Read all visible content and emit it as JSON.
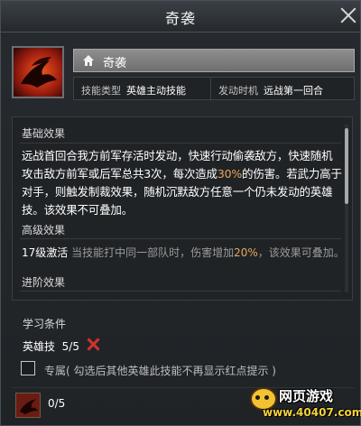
{
  "window": {
    "title": "奇袭"
  },
  "skill": {
    "name": "奇袭",
    "type_label": "技能类型",
    "type_value": "英雄主动技能",
    "timing_label": "发动时机",
    "timing_value": "远战第一回合"
  },
  "basic_effect": {
    "heading": "基础效果",
    "text_before": "远战首回合我方前军存活时发动，快速行动偷袭敌方，快速随机攻击敌方前军或后军总共3次，每次造成",
    "highlight": "30%",
    "text_after": "的伤害。若武力高于对手，则触发制裁效果，随机沉默敌方任意一个仍未发动的英雄技。该效果不可叠加。"
  },
  "advanced_effect": {
    "heading": "高级效果",
    "level_label": "17级激活",
    "text_before": " 当技能打中同一部队时，伤害增加",
    "highlight": "20%",
    "text_after": "，该效果可叠加。"
  },
  "promotion_effect": {
    "heading": "进阶效果"
  },
  "learn": {
    "heading": "学习条件",
    "requirement_label": "英雄技",
    "requirement_value": "5/5"
  },
  "option": {
    "label": "专属( 勾选后其他英雄此技能不再显示红点提示 )",
    "checked": false
  },
  "footer": {
    "count": "0/5"
  },
  "watermark": {
    "title": "网页游戏",
    "url": "www.40407.com"
  },
  "colors": {
    "highlight": "#e6a85c",
    "fail": "#d4322b",
    "background": "#1a1d20"
  }
}
